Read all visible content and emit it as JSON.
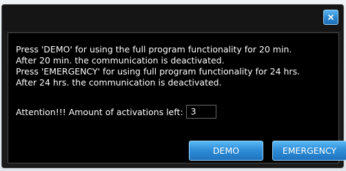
{
  "dialog": {
    "close_icon": "close-icon",
    "message_lines": [
      "Press 'DEMO' for using the full program functionality for 20 min.",
      "After 20 min. the communication is deactivated.",
      "Press 'EMERGENCY' for using full program functionality for 24 hrs.",
      "After 24 hrs. the communication is deactivated."
    ],
    "attention_label": "Attention!!! Amount of activations left:",
    "activations_left": "3",
    "buttons": {
      "demo_label": "DEMO",
      "emergency_label": "EMERGENCY"
    },
    "colors": {
      "accent": "#2f8ed8",
      "background": "#000000",
      "text": "#ffffff"
    }
  }
}
